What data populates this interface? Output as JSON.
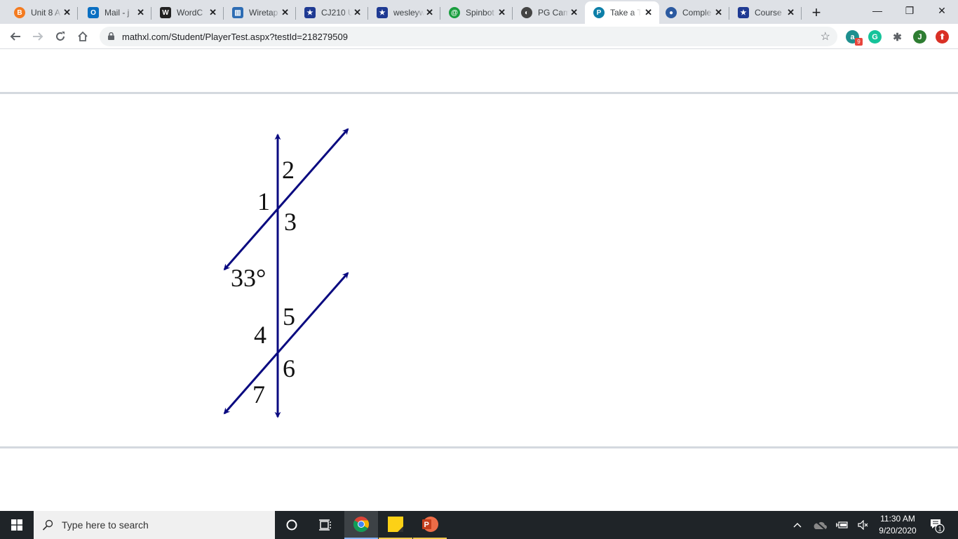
{
  "browser": {
    "tabs": [
      {
        "label": "Unit 8 A",
        "icon": "blackboard-icon",
        "color": "#f47b20",
        "glyph": "B"
      },
      {
        "label": "Mail - j",
        "icon": "outlook-icon",
        "color": "#0a6fc2",
        "glyph": "O"
      },
      {
        "label": "WordC",
        "icon": "wordcounter-icon",
        "color": "#222222",
        "glyph": "W"
      },
      {
        "label": "Wiretap",
        "icon": "wiretap-icon",
        "color": "#2e6db4",
        "glyph": "▥"
      },
      {
        "label": "CJ210 U",
        "icon": "shield-star-icon",
        "color": "#1f3a93",
        "glyph": "★"
      },
      {
        "label": "wesleyw",
        "icon": "shield-star-icon",
        "color": "#1f3a93",
        "glyph": "★"
      },
      {
        "label": "Spinbot",
        "icon": "spinbot-icon",
        "color": "#1a9e3f",
        "glyph": "@"
      },
      {
        "label": "PG Cam",
        "icon": "pg-globe-icon",
        "color": "#444444",
        "glyph": "◐"
      },
      {
        "label": "Take a T",
        "icon": "pearson-icon",
        "color": "#0d7fa8",
        "glyph": "P",
        "active": true
      },
      {
        "label": "Comple",
        "icon": "complete-icon",
        "color": "#2c5aa0",
        "glyph": "●"
      },
      {
        "label": "Course",
        "icon": "shield-star-icon",
        "color": "#1f3a93",
        "glyph": "★"
      }
    ],
    "new_tab_label": "+",
    "window_controls": {
      "minimize": "—",
      "restore": "❐",
      "close": "✕"
    },
    "url": "mathxl.com/Student/PlayerTest.aspx?testId=218279509",
    "extensions": [
      {
        "name": "alexa-icon",
        "glyph": "a",
        "color": "#1e8f8f",
        "badge": "9"
      },
      {
        "name": "grammarly-icon",
        "glyph": "G",
        "color": "#15c39a"
      },
      {
        "name": "puzzle-icon",
        "glyph": "✱",
        "color": "#5f6368"
      },
      {
        "name": "profile-avatar",
        "glyph": "J",
        "color": "#2e7d32"
      },
      {
        "name": "update-icon",
        "glyph": "⬆",
        "color": "#d93025"
      }
    ]
  },
  "figure": {
    "angle_labels": [
      "1",
      "2",
      "3",
      "4",
      "5",
      "6",
      "7"
    ],
    "given_angle": "33°",
    "line_color": "#0a0a80"
  },
  "taskbar": {
    "search_placeholder": "Type here to search",
    "time": "11:30 AM",
    "date": "9/20/2020",
    "notification_count": "1"
  }
}
